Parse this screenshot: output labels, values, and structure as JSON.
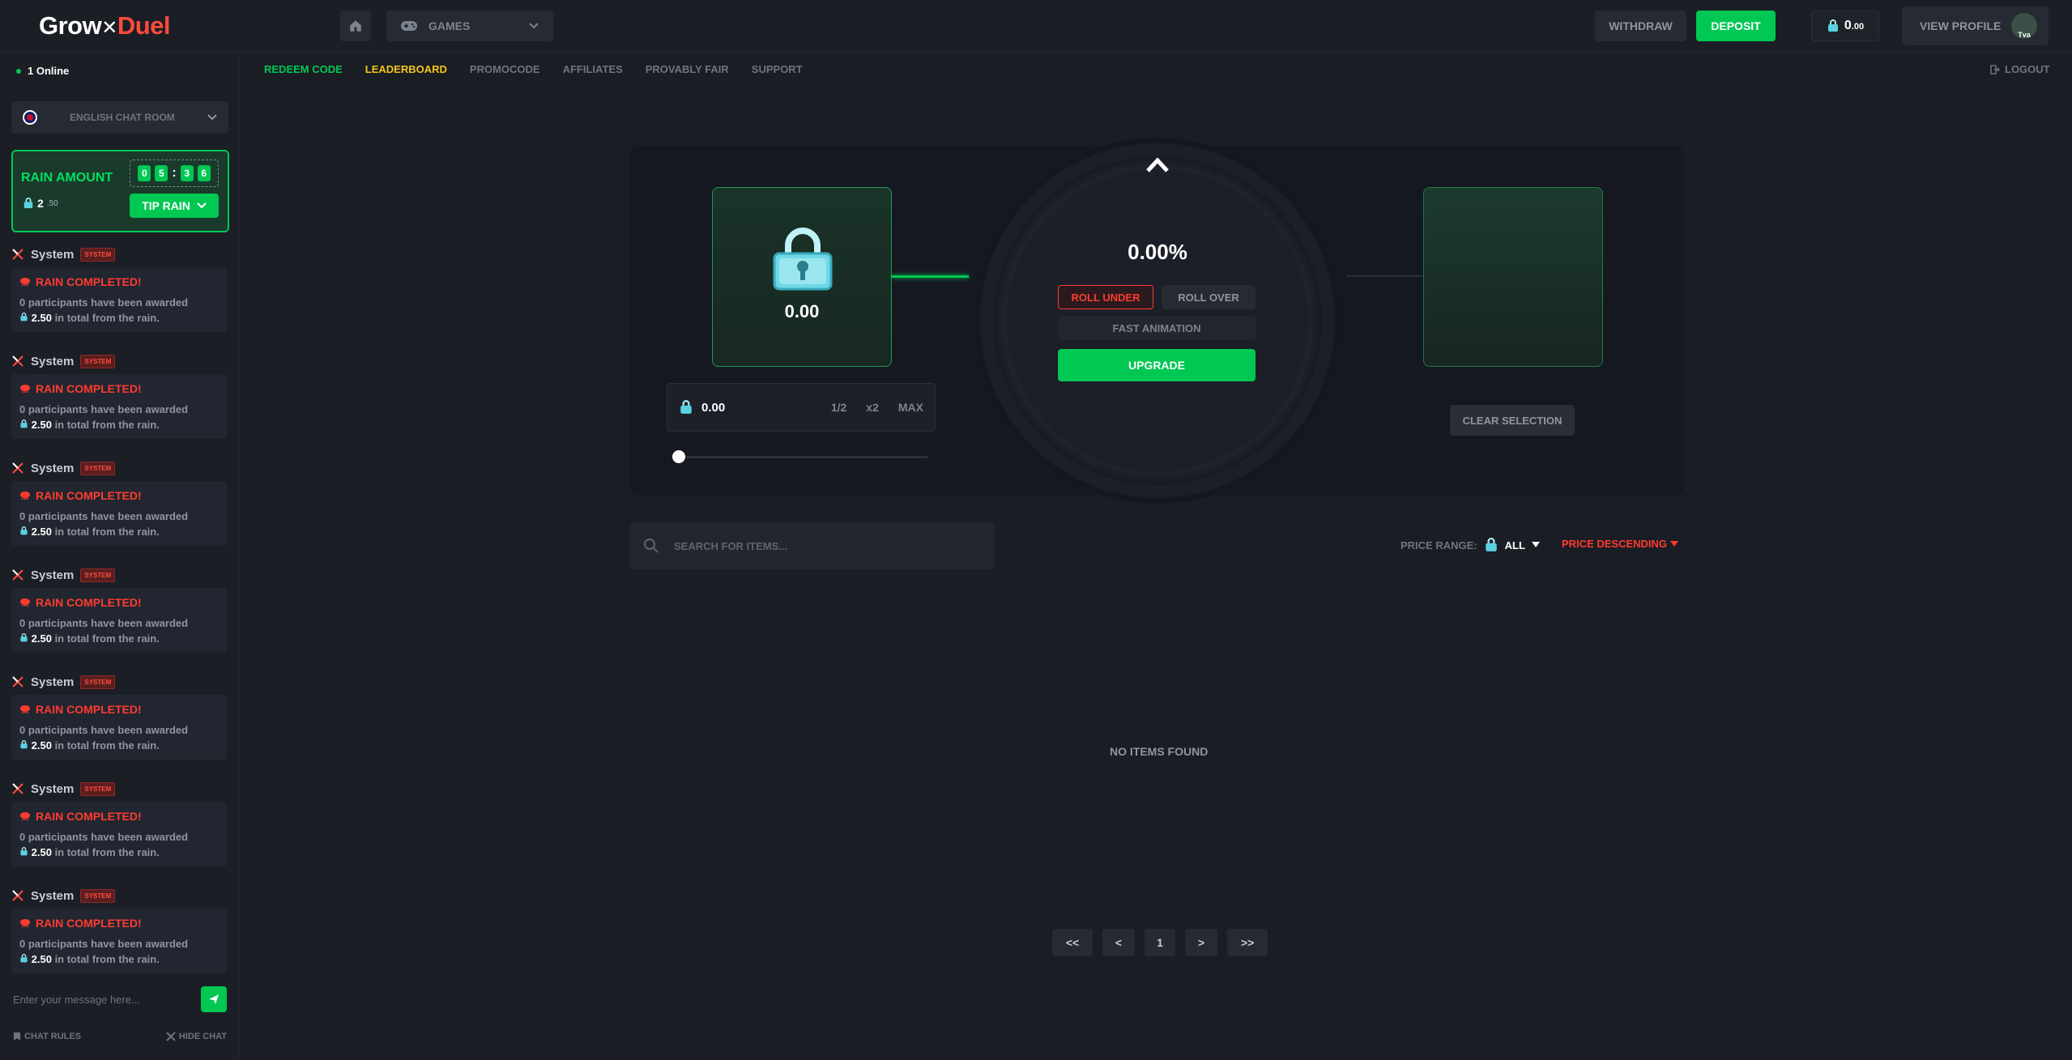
{
  "header": {
    "logo_grow": "Grow",
    "logo_duel": "Duel",
    "games_label": "GAMES",
    "withdraw_label": "WITHDRAW",
    "deposit_label": "DEPOSIT",
    "balance_main": "0",
    "balance_dec": ".00",
    "view_profile_label": "VIEW PROFILE",
    "avatar_text": "Tva"
  },
  "subnav": {
    "redeem": "REDEEM CODE",
    "leaderboard": "LEADERBOARD",
    "promocode": "PROMOCODE",
    "affiliates": "AFFILIATES",
    "provably_fair": "PROVABLY FAIR",
    "support": "SUPPORT",
    "logout": "LOGOUT"
  },
  "sidebar": {
    "online": "1 Online",
    "chat_room": "ENGLISH CHAT ROOM",
    "rain": {
      "title": "RAIN AMOUNT",
      "amount_main": "2",
      "amount_dec": ".50",
      "timer": [
        "0",
        "5",
        "3",
        "6"
      ],
      "tip_label": "TIP RAIN"
    },
    "messages": [
      {
        "user": "System",
        "badge": "SYSTEM",
        "title": "RAIN COMPLETED!",
        "line1": "0 participants have been awarded",
        "amount": "2.50",
        "line2": "in total from the rain."
      },
      {
        "user": "System",
        "badge": "SYSTEM",
        "title": "RAIN COMPLETED!",
        "line1": "0 participants have been awarded",
        "amount": "2.50",
        "line2": "in total from the rain."
      },
      {
        "user": "System",
        "badge": "SYSTEM",
        "title": "RAIN COMPLETED!",
        "line1": "0 participants have been awarded",
        "amount": "2.50",
        "line2": "in total from the rain."
      },
      {
        "user": "System",
        "badge": "SYSTEM",
        "title": "RAIN COMPLETED!",
        "line1": "0 participants have been awarded",
        "amount": "2.50",
        "line2": "in total from the rain."
      },
      {
        "user": "System",
        "badge": "SYSTEM",
        "title": "RAIN COMPLETED!",
        "line1": "0 participants have been awarded",
        "amount": "2.50",
        "line2": "in total from the rain."
      },
      {
        "user": "System",
        "badge": "SYSTEM",
        "title": "RAIN COMPLETED!",
        "line1": "0 participants have been awarded",
        "amount": "2.50",
        "line2": "in total from the rain."
      },
      {
        "user": "System",
        "badge": "SYSTEM",
        "title": "RAIN COMPLETED!",
        "line1": "0 participants have been awarded",
        "amount": "2.50",
        "line2": "in total from the rain."
      }
    ],
    "chat_placeholder": "Enter your message here...",
    "chat_rules": "CHAT RULES",
    "hide_chat": "HIDE CHAT"
  },
  "game": {
    "item_value": "0.00",
    "percent": "0.00%",
    "roll_under": "ROLL UNDER",
    "roll_over": "ROLL OVER",
    "fast_animation": "FAST ANIMATION",
    "upgrade": "UPGRADE",
    "bet_amount": "0.00",
    "half": "1/2",
    "double": "x2",
    "max": "MAX",
    "slider_value": 0,
    "clear_selection": "CLEAR SELECTION"
  },
  "items": {
    "search_placeholder": "SEARCH FOR ITEMS...",
    "price_range_label": "PRICE RANGE:",
    "price_range_value": "ALL",
    "sort_label": "PRICE DESCENDING",
    "empty": "NO ITEMS FOUND"
  },
  "pagination": {
    "first": "<<",
    "prev": "<",
    "page": "1",
    "next": ">",
    "last": ">>"
  },
  "colors": {
    "accent_green": "#00c853",
    "accent_red": "#ff3b30",
    "gold": "#f5c518",
    "bg": "#1a1d24"
  }
}
